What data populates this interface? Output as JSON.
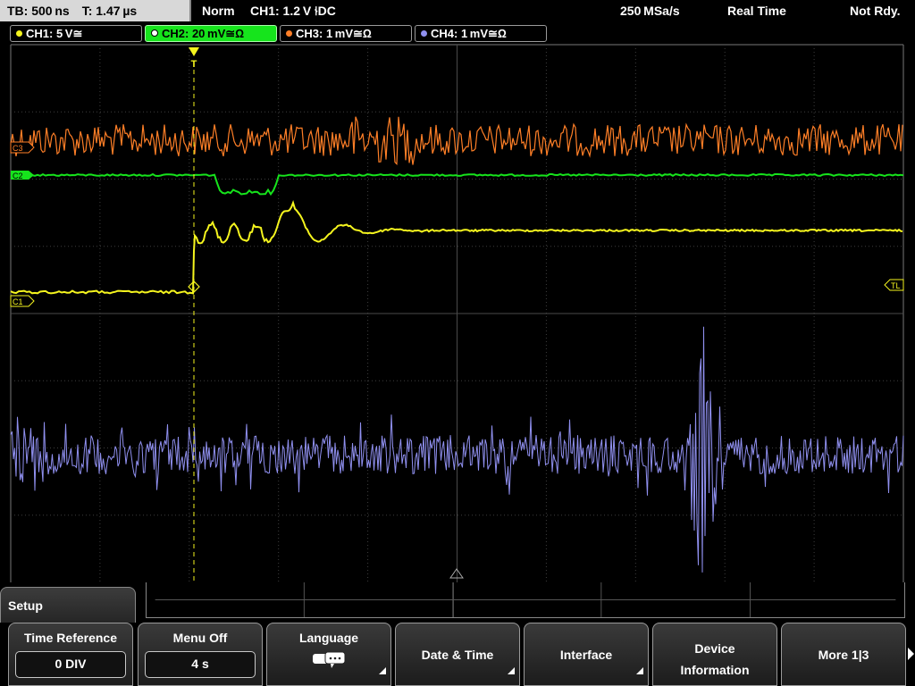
{
  "topbar": {
    "timebase": "TB: 500 ns",
    "trigger_time": "T: 1.47 µs",
    "mode": "Norm",
    "trigger": "CH1: 1.2 V ⫮DC",
    "sample_rate": "250 MSa/s",
    "acq_mode": "Real Time",
    "status": "Not Rdy."
  },
  "channels": [
    {
      "label": "CH1: 5 V≅",
      "color": "#f5f51e"
    },
    {
      "label": "CH2: 20 mV≅Ω",
      "color": "#16e41c"
    },
    {
      "label": "CH3: 1 mV≅Ω",
      "color": "#ff7f27"
    },
    {
      "label": "CH4: 1 mV≅Ω",
      "color": "#9090f0"
    }
  ],
  "markers": {
    "c1_ref": "C1",
    "c2_ref": "C2",
    "c3_ref": "C3",
    "trigger_level": "TL",
    "trigger_pos": "T"
  },
  "setup": {
    "title": "Setup",
    "softkeys": {
      "time_reference": {
        "label": "Time Reference",
        "value": "0 DIV"
      },
      "menu_off": {
        "label": "Menu Off",
        "value": "4 s"
      },
      "language": {
        "label": "Language",
        "icon": "speech-bubble-icon"
      },
      "date_time": {
        "label": "Date & Time"
      },
      "interface": {
        "label": "Interface"
      },
      "device_info": {
        "line1": "Device",
        "line2": "Information"
      },
      "more": {
        "label": "More 1|3"
      }
    }
  },
  "colors": {
    "ch1": "#f5f51e",
    "ch2": "#16e41c",
    "ch3": "#ff7f27",
    "ch4": "#9090f0",
    "grid": "#4a4a4a"
  }
}
